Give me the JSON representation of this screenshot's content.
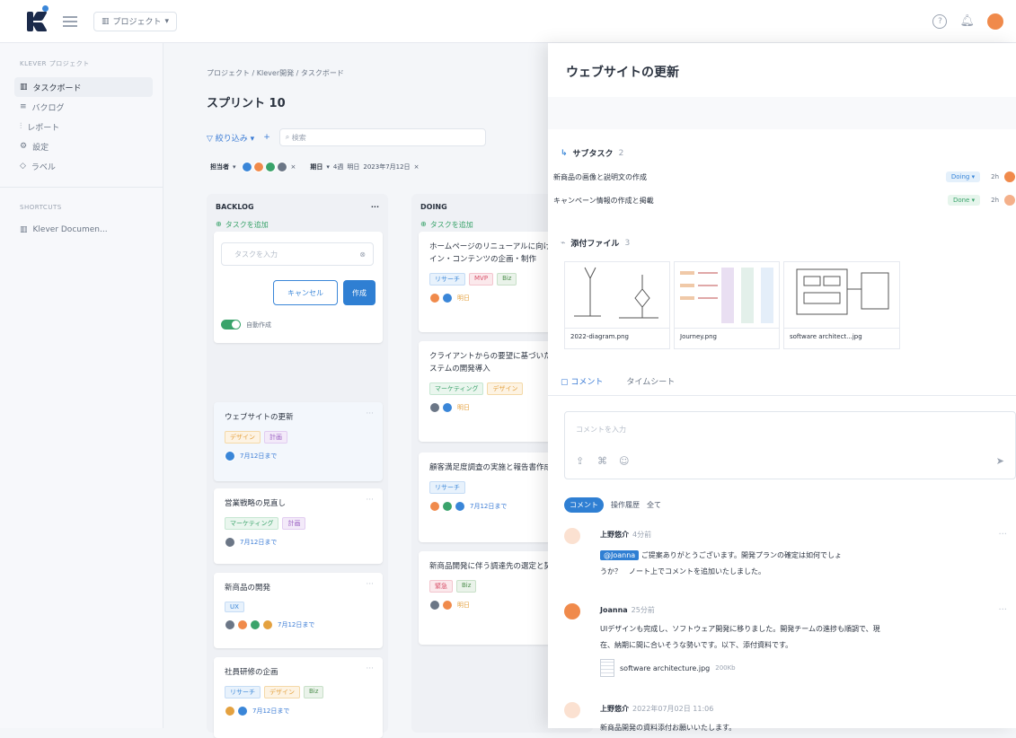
{
  "topbar": {
    "project_selector": "プロジェクト"
  },
  "sidebar": {
    "header": "KLEVER プロジェクト",
    "items": [
      {
        "label": "タスクボード",
        "icon": "board-icon"
      },
      {
        "label": "バクログ",
        "icon": "list-icon"
      },
      {
        "label": "レポート",
        "icon": "chart-icon"
      },
      {
        "label": "設定",
        "icon": "gear-icon"
      },
      {
        "label": "ラベル",
        "icon": "tag-icon"
      }
    ],
    "shortcuts_header": "SHORTCUTS",
    "shortcut": "Klever Documen..."
  },
  "main": {
    "breadcrumb": "プロジェクト / Klever開発 / タスクボード",
    "title": "スプリント 10",
    "filter_label": "絞り込み",
    "search_placeholder": "検索",
    "chips": {
      "assignee": "担当者",
      "deadline": "期日",
      "opt1": "4週",
      "opt2": "明日",
      "date": "2023年7月12日"
    }
  },
  "backlog": {
    "name": "BACKLOG",
    "add_task": "タスクを追加",
    "new_task_placeholder": "タスクを入力",
    "cancel": "キャンセル",
    "create": "作成",
    "toggle_label": "自動作成",
    "cards": [
      {
        "title": "ウェブサイトの更新",
        "tags": [
          "デザイン",
          "計画"
        ],
        "due": "7月12日まで"
      },
      {
        "title": "営業戦略の見直し",
        "tags": [
          "マーケティング",
          "計画"
        ],
        "due": "7月12日まで"
      },
      {
        "title": "新商品の開発",
        "tags": [
          "UX"
        ],
        "due": "7月12日まで"
      },
      {
        "title": "社員研修の企画",
        "tags": [
          "リサーチ",
          "デザイン",
          "Biz"
        ],
        "due": "7月12日まで"
      }
    ]
  },
  "doing": {
    "name": "DOING",
    "add_task": "タスクを追加",
    "cards": [
      {
        "title": "ホームページのリニューアルに向けたデザイン・コンテンツの企画・制作",
        "tags": [
          "リサーチ",
          "MVP",
          "Biz"
        ],
        "due": "明日"
      },
      {
        "title": "クライアントからの要望に基づいた大型システムの開発導入",
        "tags": [
          "マーケティング",
          "デザイン"
        ],
        "due": "明日"
      },
      {
        "title": "顧客満足度調査の実施と報告書作成",
        "tags": [
          "リサーチ"
        ],
        "due": "7月12日まで"
      },
      {
        "title": "新商品開発に伴う調達先の選定と契約交渉",
        "tags": [
          "緊急",
          "Biz"
        ],
        "due": "明日"
      }
    ]
  },
  "panel": {
    "title": "ウェブサイトの更新",
    "subtasks_label": "サブタスク",
    "subtasks_count": "2",
    "subtasks": [
      {
        "label": "新商品の画像と説明文の作成",
        "status": "Doing",
        "hours": "2h"
      },
      {
        "label": "キャンペーン情報の作成と掲載",
        "status": "Done",
        "hours": "2h"
      }
    ],
    "attachments_label": "添付ファイル",
    "attachments_count": "3",
    "attachments": [
      "2022-diagram.png",
      "Journey.png",
      "software architect...jpg"
    ],
    "tabs": [
      "コメント",
      "タイムシート"
    ],
    "comment_placeholder": "コメントを入力",
    "filter_tabs": [
      "コメント",
      "操作履歴",
      "全て"
    ],
    "comments": [
      {
        "author": "上野悠介",
        "time": "4分前",
        "mention": "@Joanna",
        "text1": "ご提案ありがとうございます。開発プランの確定は如何でしょ",
        "text2": "うか？　ノート上でコメントを追加いたしました。"
      },
      {
        "author": "Joanna",
        "time": "25分前",
        "text1": "UIデザインも完成し、ソフトウェア開発に移りました。開発チームの進捗も順調で、現",
        "text2": "在、納期に間に合いそうな勢いです。以下、添付資料です。",
        "file": "software architecture.jpg",
        "size": "200Kb"
      },
      {
        "author": "上野悠介",
        "time": "2022年07月02日 11:06",
        "text1": "新商品開発の資料添付お願いいたします。"
      }
    ]
  },
  "colors": {
    "accent": "#2f7fd3",
    "green": "#3aa36b",
    "orange": "#f08a4b"
  }
}
